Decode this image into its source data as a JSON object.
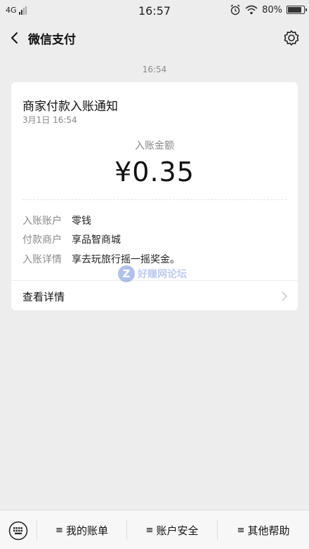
{
  "status": {
    "network": "4G",
    "time": "16:57",
    "battery": "80%",
    "battery_level": 0.8
  },
  "nav": {
    "title": "微信支付"
  },
  "timestamp": "16:54",
  "card": {
    "title": "商家付款入账通知",
    "date": "3月1日  16:54",
    "amount_label": "入账金额",
    "amount": "¥0.35",
    "rows": [
      {
        "key": "入账账户",
        "value": "零钱"
      },
      {
        "key": "付款商户",
        "value": "享品智商城"
      },
      {
        "key": "入账详情",
        "value": "享去玩旅行摇一摇奖金。"
      }
    ],
    "details_label": "查看详情"
  },
  "watermark": {
    "logo": "Z",
    "text": "好赚网论坛"
  },
  "bottom": {
    "menu_glyph": "≡",
    "tabs": [
      {
        "label": "我的账单"
      },
      {
        "label": "账户安全"
      },
      {
        "label": "其他帮助"
      }
    ]
  },
  "colors": {
    "background": "#ededed",
    "card": "#ffffff",
    "text": "#1a1a1a",
    "muted": "#8a8a8a"
  }
}
